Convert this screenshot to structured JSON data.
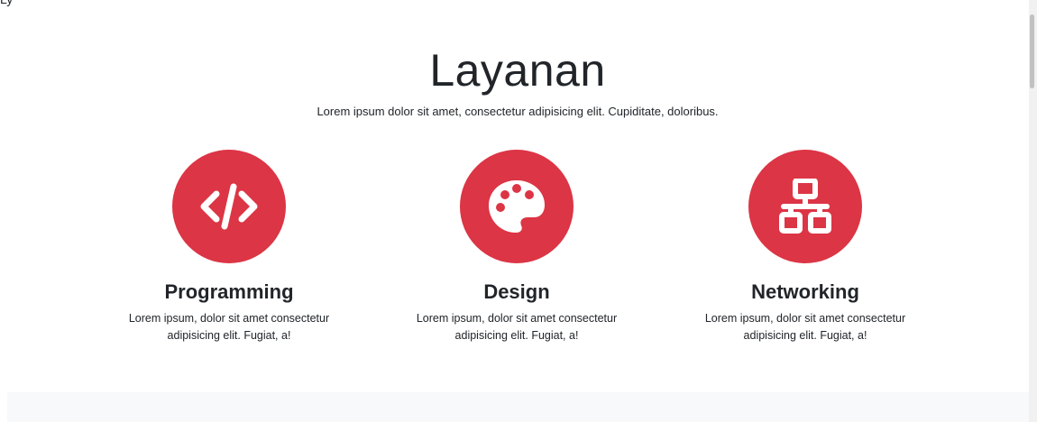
{
  "header": {
    "brand_partial": "Ly"
  },
  "section": {
    "title": "Layanan",
    "subtitle": "Lorem ipsum dolor sit amet, consectetur adipisicing elit. Cupiditate, doloribus."
  },
  "services": [
    {
      "icon": "code-icon",
      "title": "Programming",
      "text": "Lorem ipsum, dolor sit amet consectetur adipisicing elit. Fugiat, a!"
    },
    {
      "icon": "palette-icon",
      "title": "Design",
      "text": "Lorem ipsum, dolor sit amet consectetur adipisicing elit. Fugiat, a!"
    },
    {
      "icon": "network-icon",
      "title": "Networking",
      "text": "Lorem ipsum, dolor sit amet consectetur adipisicing elit. Fugiat, a!"
    }
  ],
  "colors": {
    "accent": "#dc3545",
    "text": "#212529",
    "next_section_bg": "#f8f9fa"
  }
}
